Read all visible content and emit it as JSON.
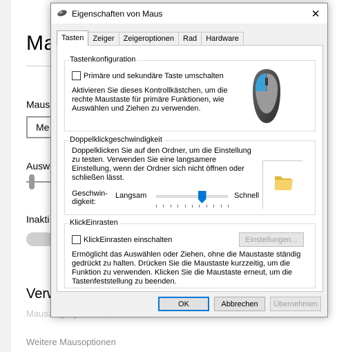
{
  "background": {
    "title": "Ma",
    "label_maus": "Maus",
    "dropdown_value": "Me",
    "label_ausw": "Ausw",
    "label_inakti": "Inakti",
    "heading_verw": "Verw",
    "faded_link": "Mauszeigergröße anpassen",
    "link_more": "Weitere Mausoptionen"
  },
  "dialog": {
    "title": "Eigenschaften von Maus",
    "close_label": "✕",
    "tabs": [
      {
        "label": "Tasten"
      },
      {
        "label": "Zeiger"
      },
      {
        "label": "Zeigeroptionen"
      },
      {
        "label": "Rad"
      },
      {
        "label": "Hardware"
      }
    ],
    "button_config": {
      "title": "Tastenkonfiguration",
      "checkbox_label": "Primäre und sekundäre Taste umschalten",
      "description": "Aktivieren Sie dieses Kontrollkästchen, um die rechte Maustaste für primäre Funktionen, wie Auswählen und Ziehen zu verwenden.",
      "checked": false
    },
    "double_click": {
      "title": "Doppelklickgeschwindigkeit",
      "description": "Doppelklicken Sie auf den Ordner, um die Einstellung zu testen. Verwenden Sie eine langsamere Einstellung, wenn der Ordner sich nicht öffnen oder schließen lässt.",
      "speed_label": "Geschwin-\ndigkeit:",
      "slow_label": "Langsam",
      "fast_label": "Schnell",
      "slider_fraction": 0.64
    },
    "click_lock": {
      "title": "KlickEinrasten",
      "checkbox_label": "KlickEinrasten einschalten",
      "settings_button": "Einstellungen...",
      "description": "Ermöglicht das Auswählen oder Ziehen, ohne die Maustaste ständig gedrückt zu halten. Drücken Sie die Maustaste kurzzeitig, um die Funktion zu verwenden. Klicken Sie die Maustaste erneut, um die Tastenfeststellung zu beenden.",
      "checked": false
    },
    "buttons": {
      "ok": "OK",
      "cancel": "Abbrechen",
      "apply": "Übernehmen"
    },
    "colors": {
      "accent": "#0078d7",
      "mouse_blue": "#3aa0d8"
    }
  }
}
